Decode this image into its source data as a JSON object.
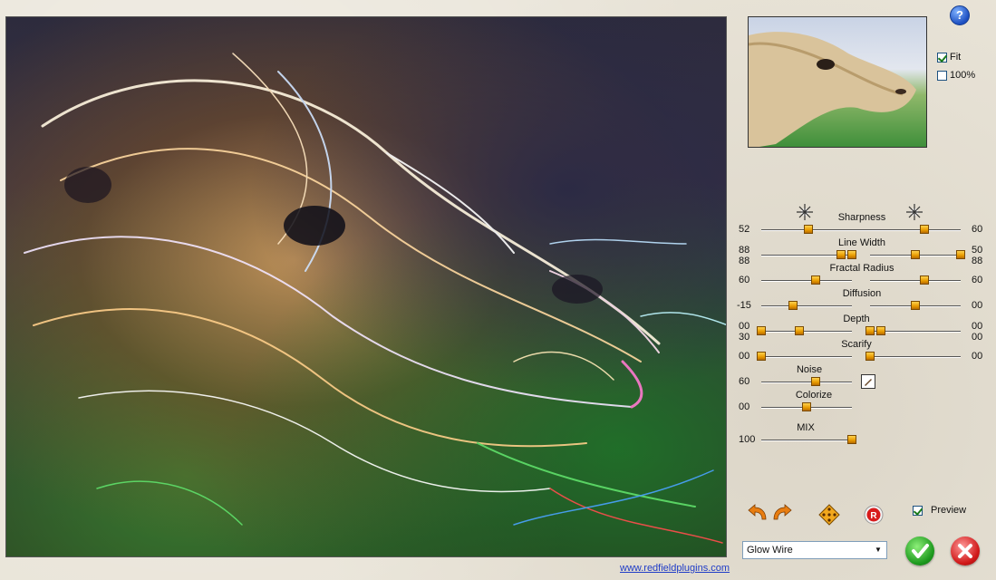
{
  "help": {
    "label": "?"
  },
  "view": {
    "fit_label": "Fit",
    "fit_checked": true,
    "full_label": "100%",
    "full_checked": false
  },
  "sliders": [
    {
      "id": "sharpness",
      "label": "Sharpness",
      "left": "52",
      "right": "60"
    },
    {
      "id": "linewidth",
      "label": "Line Width",
      "left": "88",
      "left2": "88",
      "right": "50",
      "right2": "88"
    },
    {
      "id": "fractal",
      "label": "Fractal Radius",
      "left": "60",
      "right": "60"
    },
    {
      "id": "diffusion",
      "label": "Diffusion",
      "left": "-15",
      "right": "00"
    },
    {
      "id": "depth",
      "label": "Depth",
      "left": "00",
      "left2": "30",
      "right": "00",
      "right2": "00"
    },
    {
      "id": "scarify",
      "label": "Scarify",
      "left": "00",
      "right": "00"
    },
    {
      "id": "noise",
      "label": "Noise",
      "left": "60"
    },
    {
      "id": "colorize",
      "label": "Colorize",
      "left": "00"
    },
    {
      "id": "mix",
      "label": "MIX",
      "left": "100"
    }
  ],
  "preview_toggle": {
    "label": "Preview",
    "checked": true
  },
  "preset": {
    "selected": "Glow Wire"
  },
  "website": {
    "text": "www.redfieldplugins.com"
  },
  "icons": {
    "undo": "undo-arrow-icon",
    "redo": "redo-arrow-icon",
    "randomize": "dice-icon",
    "reset": "reset-r-icon",
    "ok": "checkmark-icon",
    "cancel": "close-x-icon",
    "noise_edit": "pencil-icon",
    "sharpness_star": "sparkle-icon"
  },
  "colors": {
    "knob": "#e89a00",
    "ok": "#1e9a1e",
    "cancel": "#d01818",
    "link": "#1f3cc7"
  }
}
